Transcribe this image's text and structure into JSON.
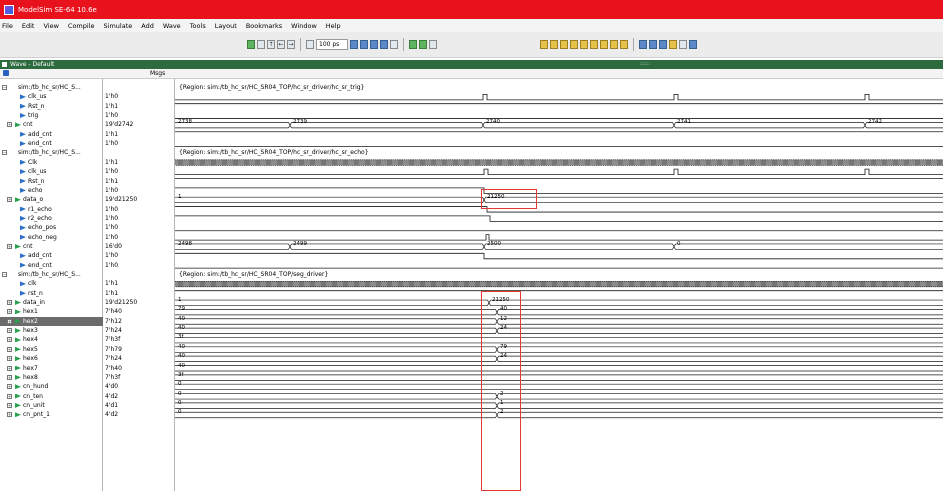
{
  "window": {
    "title": "ModelSim SE-64 10.6e"
  },
  "menu": [
    "File",
    "Edit",
    "View",
    "Compile",
    "Simulate",
    "Add",
    "Wave",
    "Tools",
    "Layout",
    "Bookmarks",
    "Window",
    "Help"
  ],
  "toolbar": {
    "zoom_value": "100 ps"
  },
  "wave_window": {
    "title": "Wave - Default",
    "msgs_header": "Msgs"
  },
  "colors": {
    "titlebar": "#e8121c",
    "wave_line": "#1a1a1a",
    "bus_line": "#1a1a1a",
    "cursor_box": "#e53935",
    "selected_row": "#6b6b6b"
  },
  "signals": [
    {
      "name": "sim:/tb_hc_sr/HC_S...",
      "value": "",
      "indent": 0,
      "kind": "group",
      "expandable": true
    },
    {
      "name": "clk_us",
      "value": "1'h0",
      "indent": 2,
      "kind": "sig",
      "expandable": false
    },
    {
      "name": "Rst_n",
      "value": "1'h1",
      "indent": 2,
      "kind": "sig",
      "expandable": false
    },
    {
      "name": "trig",
      "value": "1'h0",
      "indent": 2,
      "kind": "sig",
      "expandable": false
    },
    {
      "name": "cnt",
      "value": "19'd2742",
      "indent": 1,
      "kind": "bus",
      "expandable": true
    },
    {
      "name": "add_cnt",
      "value": "1'h1",
      "indent": 2,
      "kind": "sig",
      "expandable": false
    },
    {
      "name": "end_cnt",
      "value": "1'h0",
      "indent": 2,
      "kind": "sig",
      "expandable": false
    },
    {
      "name": "sim:/tb_hc_sr/HC_S...",
      "value": "",
      "indent": 0,
      "kind": "group",
      "expandable": true
    },
    {
      "name": "Clk",
      "value": "1'h1",
      "indent": 2,
      "kind": "sig",
      "expandable": false
    },
    {
      "name": "clk_us",
      "value": "1'h0",
      "indent": 2,
      "kind": "sig",
      "expandable": false
    },
    {
      "name": "Rst_n",
      "value": "1'h1",
      "indent": 2,
      "kind": "sig",
      "expandable": false
    },
    {
      "name": "echo",
      "value": "1'h0",
      "indent": 2,
      "kind": "sig",
      "expandable": false
    },
    {
      "name": "data_o",
      "value": "19'd21250",
      "indent": 1,
      "kind": "bus",
      "expandable": true
    },
    {
      "name": "r1_echo",
      "value": "1'h0",
      "indent": 2,
      "kind": "sig",
      "expandable": false
    },
    {
      "name": "r2_echo",
      "value": "1'h0",
      "indent": 2,
      "kind": "sig",
      "expandable": false
    },
    {
      "name": "echo_pos",
      "value": "1'h0",
      "indent": 2,
      "kind": "sig",
      "expandable": false
    },
    {
      "name": "echo_neg",
      "value": "1'h0",
      "indent": 2,
      "kind": "sig",
      "expandable": false
    },
    {
      "name": "cnt",
      "value": "16'd0",
      "indent": 1,
      "kind": "bus",
      "expandable": true
    },
    {
      "name": "add_cnt",
      "value": "1'h0",
      "indent": 2,
      "kind": "sig",
      "expandable": false
    },
    {
      "name": "end_cnt",
      "value": "1'h0",
      "indent": 2,
      "kind": "sig",
      "expandable": false
    },
    {
      "name": "sim:/tb_hc_sr/HC_S...",
      "value": "",
      "indent": 0,
      "kind": "group",
      "expandable": true
    },
    {
      "name": "clk",
      "value": "1'h1",
      "indent": 2,
      "kind": "sig",
      "expandable": false
    },
    {
      "name": "rst_n",
      "value": "1'h1",
      "indent": 2,
      "kind": "sig",
      "expandable": false
    },
    {
      "name": "data_in",
      "value": "19'd21250",
      "indent": 1,
      "kind": "bus",
      "expandable": true
    },
    {
      "name": "hex1",
      "value": "7'h40",
      "indent": 1,
      "kind": "bus",
      "expandable": true
    },
    {
      "name": "hex2",
      "value": "7'h12",
      "indent": 1,
      "kind": "bus",
      "expandable": true,
      "selected": true
    },
    {
      "name": "hex3",
      "value": "7'h24",
      "indent": 1,
      "kind": "bus",
      "expandable": true
    },
    {
      "name": "hex4",
      "value": "7'h3f",
      "indent": 1,
      "kind": "bus",
      "expandable": true
    },
    {
      "name": "hex5",
      "value": "7'h79",
      "indent": 1,
      "kind": "bus",
      "expandable": true
    },
    {
      "name": "hex6",
      "value": "7'h24",
      "indent": 1,
      "kind": "bus",
      "expandable": true
    },
    {
      "name": "hex7",
      "value": "7'h40",
      "indent": 1,
      "kind": "bus",
      "expandable": true
    },
    {
      "name": "hex8",
      "value": "7'h3f",
      "indent": 1,
      "kind": "bus",
      "expandable": true
    },
    {
      "name": "cn_hund",
      "value": "4'd0",
      "indent": 1,
      "kind": "bus",
      "expandable": true
    },
    {
      "name": "cn_ten",
      "value": "4'd2",
      "indent": 1,
      "kind": "bus",
      "expandable": true
    },
    {
      "name": "cn_unit",
      "value": "4'd1",
      "indent": 1,
      "kind": "bus",
      "expandable": true
    },
    {
      "name": "cn_pnt_1",
      "value": "4'd2",
      "indent": 1,
      "kind": "bus",
      "expandable": true
    }
  ],
  "regions": [
    {
      "row": 0,
      "text": "{Region: sim:/tb_hc_sr/HC_SR04_TOP/hc_sr_driver/hc_sr_trig}"
    },
    {
      "row": 7,
      "text": "{Region: sim:/tb_hc_sr/HC_SR04_TOP/hc_sr_driver/hc_sr_echo}"
    },
    {
      "row": 20,
      "text": "{Region: sim:/tb_hc_sr/HC_SR04_TOP/seg_driver}"
    }
  ],
  "bus_values": {
    "cnt_trig": [
      "2738",
      "2739",
      "2740",
      "2741",
      "2742"
    ],
    "data_o": [
      "1",
      "21250"
    ],
    "cnt_echo": [
      "2498",
      "2499",
      "2500",
      "0"
    ],
    "data_in": [
      "1",
      "21250"
    ],
    "hex1": [
      "79",
      "40"
    ],
    "hex2": [
      "40",
      "12"
    ],
    "hex3": [
      "40",
      "24"
    ],
    "hex4": [
      "3f"
    ],
    "hex5": [
      "40",
      "79"
    ],
    "hex6": [
      "40",
      "24"
    ],
    "hex7": [
      "40"
    ],
    "hex8": [
      "3f"
    ],
    "cn_hund": [
      "0"
    ],
    "cn_ten": [
      "0",
      "2"
    ],
    "cn_unit": [
      "0",
      "1"
    ],
    "cn_pnt_1": [
      "0",
      "2"
    ]
  }
}
